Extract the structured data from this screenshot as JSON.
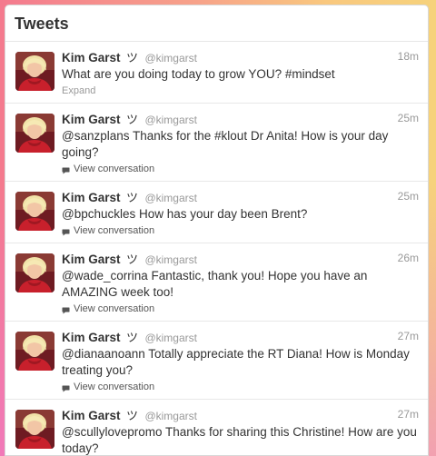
{
  "panel": {
    "title": "Tweets"
  },
  "tweets": [
    {
      "name": "Kim Garst",
      "symbol": "ツ",
      "handle": "@kimgarst",
      "time": "18m",
      "text": "What are you doing today to grow YOU? #mindset",
      "action": "Expand"
    },
    {
      "name": "Kim Garst",
      "symbol": "ツ",
      "handle": "@kimgarst",
      "time": "25m",
      "text": "@sanzplans Thanks for the #klout Dr Anita! How is your day going?",
      "action": "View conversation"
    },
    {
      "name": "Kim Garst",
      "symbol": "ツ",
      "handle": "@kimgarst",
      "time": "25m",
      "text": "@bpchuckles How has your day been Brent?",
      "action": "View conversation"
    },
    {
      "name": "Kim Garst",
      "symbol": "ツ",
      "handle": "@kimgarst",
      "time": "26m",
      "text": "@wade_corrina Fantastic, thank you! Hope you have an AMAZING week too!",
      "action": "View conversation"
    },
    {
      "name": "Kim Garst",
      "symbol": "ツ",
      "handle": "@kimgarst",
      "time": "27m",
      "text": "@dianaanoann Totally appreciate the RT Diana! How is Monday treating you?",
      "action": "View conversation"
    },
    {
      "name": "Kim Garst",
      "symbol": "ツ",
      "handle": "@kimgarst",
      "time": "27m",
      "text": "@scullylovepromo Thanks for sharing this Christine! How are you today?",
      "action": "View conversation"
    }
  ],
  "icons": {
    "conversation": "speech-bubble-icon"
  },
  "colors": {
    "name": "#333333",
    "muted": "#999999",
    "divider": "#e8e8e8"
  }
}
